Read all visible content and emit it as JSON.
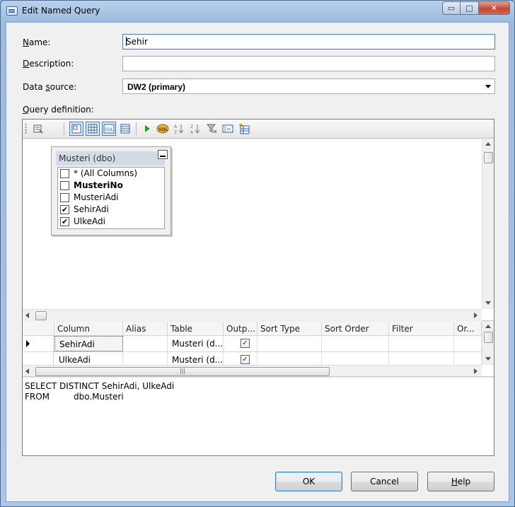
{
  "window": {
    "title": "Edit Named Query",
    "caption_buttons": {
      "minimize": "▭",
      "maximize": "□",
      "close": "✕"
    }
  },
  "form": {
    "name_label_u": "N",
    "name_label_rest": "ame:",
    "name_value": "Sehir",
    "description_label_u": "D",
    "description_label_rest": "escription:",
    "description_value": "",
    "datasource_label_pre": "Data ",
    "datasource_label_u": "s",
    "datasource_label_rest": "ource:",
    "datasource_value": "DW2 (primary)",
    "query_def_label_u": "Q",
    "query_def_label_rest": "uery definition:"
  },
  "diagram": {
    "table_title": "Musteri (dbo)",
    "columns": [
      {
        "name": "* (All Columns)",
        "checked": false,
        "key": false
      },
      {
        "name": "MusteriNo",
        "checked": false,
        "key": true
      },
      {
        "name": "MusteriAdi",
        "checked": false,
        "key": false
      },
      {
        "name": "SehirAdi",
        "checked": true,
        "key": false
      },
      {
        "name": "UlkeAdi",
        "checked": true,
        "key": false
      }
    ]
  },
  "grid": {
    "headers": [
      "Column",
      "Alias",
      "Table",
      "Outp...",
      "Sort Type",
      "Sort Order",
      "Filter",
      "Or..."
    ],
    "rows": [
      {
        "column": "SehirAdi",
        "alias": "",
        "table": "Musteri (d...",
        "output": true,
        "current": true
      },
      {
        "column": "UlkeAdi",
        "alias": "",
        "table": "Musteri (d...",
        "output": true,
        "current": false
      }
    ]
  },
  "sql": {
    "line1": "SELECT DISTINCT SehirAdi, UlkeAdi",
    "line2_kw": "FROM",
    "line2_rest": "dbo.Musteri"
  },
  "buttons": {
    "ok": "OK",
    "cancel": "Cancel",
    "help_u": "H",
    "help_rest": "elp"
  },
  "icons": {
    "check": "✔",
    "grid_check": "✓",
    "scroll_grip": "|||"
  }
}
